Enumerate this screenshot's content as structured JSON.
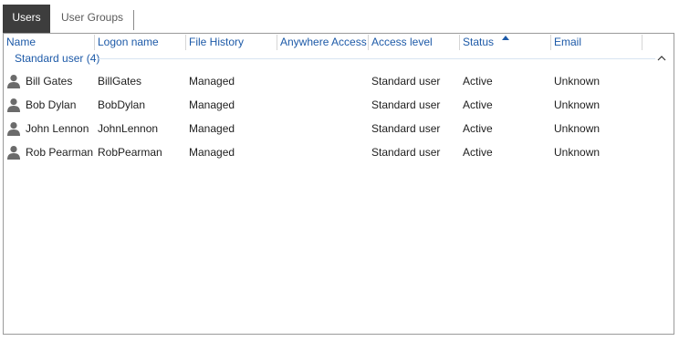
{
  "tabs": [
    {
      "label": "Users",
      "active": true
    },
    {
      "label": "User Groups",
      "active": false
    }
  ],
  "columns": [
    "Name",
    "Logon name",
    "File History",
    "Anywhere Access",
    "Access level",
    "Status",
    "Email"
  ],
  "sorted_column": "Status",
  "group": {
    "label": "Standard user (4)",
    "expanded": true
  },
  "rows": [
    {
      "icon": "user-icon",
      "name": "Bill Gates",
      "logon": "BillGates",
      "file_history": "Managed",
      "anywhere_access": "",
      "access_level": "Standard user",
      "status": "Active",
      "email": "Unknown"
    },
    {
      "icon": "user-icon",
      "name": "Bob Dylan",
      "logon": "BobDylan",
      "file_history": "Managed",
      "anywhere_access": "",
      "access_level": "Standard user",
      "status": "Active",
      "email": "Unknown"
    },
    {
      "icon": "user-icon",
      "name": "John Lennon",
      "logon": "JohnLennon",
      "file_history": "Managed",
      "anywhere_access": "",
      "access_level": "Standard user",
      "status": "Active",
      "email": "Unknown"
    },
    {
      "icon": "user-icon",
      "name": "Rob Pearman",
      "logon": "RobPearman",
      "file_history": "Managed",
      "anywhere_access": "",
      "access_level": "Standard user",
      "status": "Active",
      "email": "Unknown"
    }
  ],
  "colors": {
    "accent": "#1d5aa8",
    "active_tab_bg": "#3d3d3d",
    "icon": "#6b6b6b"
  }
}
